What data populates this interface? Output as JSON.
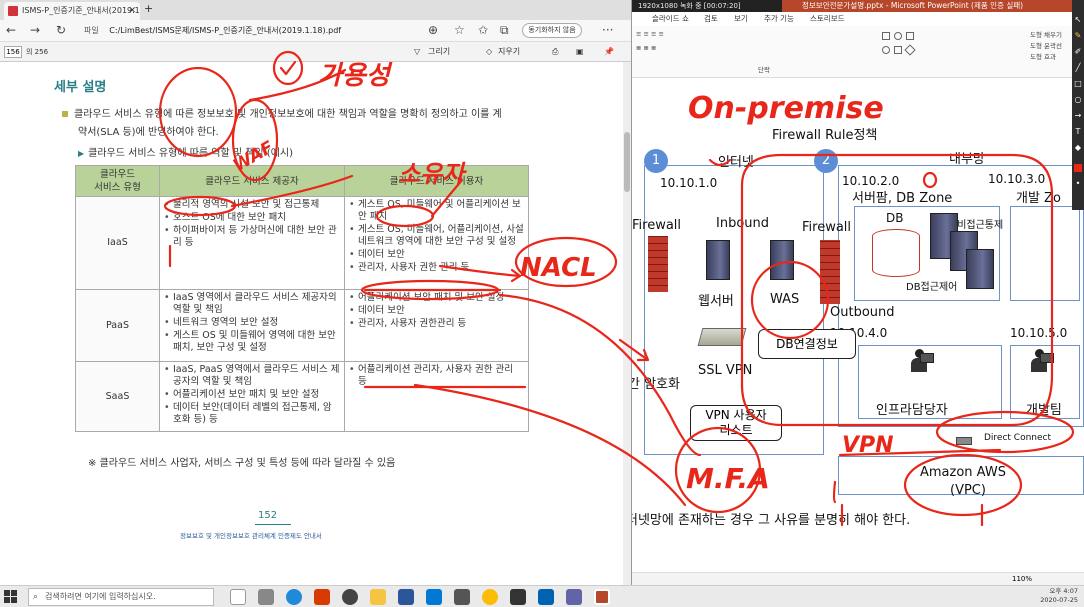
{
  "edge": {
    "tab_title": "ISMS-P_인증기준_안내서(2019.1",
    "new_tab": "+",
    "address_label": "파일",
    "address_url": "C:/LimBest/ISMS문제/ISMS-P_인증기준_안내서(2019.1.18).pdf",
    "sync_label": "동기화하지 않음"
  },
  "pdf_toolbar": {
    "page_current": "156",
    "page_total": "의 256",
    "draw_label": "그리기",
    "erase_label": "지우기"
  },
  "doc": {
    "heading": "세부 설명",
    "para_line1": "클라우드 서비스 유형에 따른 정보보호 및 개인정보보호에 대한 책임과 역할을 명확히 정의하고 이를 계",
    "para_line2": "약서(SLA 등)에 반영하여야 한다.",
    "sub_bullet": "클라우드 서비스 유형에 따른 역할 및 책임 (예시)",
    "table": {
      "headers": [
        "클라우드\n서비스 유형",
        "클라우드 서비스 제공자",
        "클라우드 서비스 이용자"
      ],
      "rows": [
        {
          "type": "IaaS",
          "provider": [
            "물리적 영역의 시설 보안 및 접근통제",
            "호스트 OS에 대한 보안 패치",
            "하이퍼바이저 등 가상머신에 대한 보안 관리 등"
          ],
          "user": [
            "게스트 OS, 미들웨어 및 어플리케이션 보안 패치",
            "게스트 OS, 미들웨어, 어플리케이션, 사설 네트워크 영역에 대한 보안 구성 및 설정",
            "데이터 보안",
            "관리자, 사용자 권한 관리 등"
          ]
        },
        {
          "type": "PaaS",
          "provider": [
            "IaaS 영역에서 클라우드 서비스 제공자의 역할 및 책임",
            "네트워크 영역의 보안 설정",
            "게스트 OS 및 미들웨어 영역에 대한 보안패치, 보안 구성 및 설정"
          ],
          "user": [
            "어플리케이션 보안 패치 및 보안 설정",
            "데이터 보안",
            "관리자, 사용자 권한관리 등"
          ]
        },
        {
          "type": "SaaS",
          "provider": [
            "IaaS, PaaS 영역에서 클라우드 서비스 제공자의 역할 및 책임",
            "어플리케이션 보안 패치 및 보안 설정",
            "데이터 보안(데이터 레벨의 접근통제, 암호화 등) 등"
          ],
          "user": [
            "어플리케이션 관리자, 사용자 권한 관리 등"
          ]
        }
      ]
    },
    "footnote": "※ 클라우드 서비스 사업자, 서비스 구성 및 특성 등에 따라 달라질 수 있음",
    "page_number": "152",
    "page_footer": "정보보호 및 개인정보보호 관리체계 인증제도 안내서"
  },
  "ppt": {
    "recorder": "1920x1080  녹화 중 [00:07:20]",
    "title": "정보보안전문가설명.pptx - Microsoft PowerPoint (제품 인증 실패)",
    "tabs": [
      "슬라이드 쇼",
      "검토",
      "보기",
      "추가 기능",
      "스토리보드"
    ],
    "ribbon_group": "단락",
    "ribbon_items": [
      "도형 채우기",
      "도형 윤곽선",
      "도형 효과"
    ]
  },
  "slide": {
    "title": "Firewall Rule정책",
    "internet_label": "인터넷",
    "internal_label": "내부망",
    "net_internet": "10.10.1.0",
    "net_server": "10.10.2.0",
    "net_dev": "10.10.3.0",
    "server_zone": "서버팜, DB Zone",
    "dev_zone": "개발 Zo",
    "db_label": "DB",
    "db_access_label": "세비접근통제",
    "db_access_label2": "DB접근제어",
    "firewall_left": "Firewall",
    "firewall_right": "Firewall",
    "inbound": "Inbound",
    "outbound": "Outbound",
    "web_server": "웹서버",
    "was": "WAS",
    "ssl_vpn": "SSL VPN",
    "encryption": "간 암호화",
    "net_infra": "10.10.4.0",
    "net_dev2": "10.10.5.0",
    "infra_admin": "인프라담당자",
    "dev_team": "개발팀",
    "direct_connect": "Direct Connect",
    "aws_line1": "Amazon AWS",
    "aws_line2": "(VPC)",
    "db_conn_callout": "DB연결정보",
    "vpn_callout_line1": "VPN 사용자",
    "vpn_callout_line2": "리스트",
    "bottom_text": "터넷망에 존재하는 경우 그 사유를 분명히 해야 한다.",
    "num1": "1",
    "num2": "2"
  },
  "annotations": {
    "on_premise": "On-premise",
    "ga_yong_seong": "가용성",
    "so_yu_ja": "소유자",
    "waf": "WAF",
    "nacl": "NACL",
    "vpn": "VPN",
    "mfa": "M.F.A"
  },
  "status": {
    "ppt_zoom": "110%",
    "search_placeholder": "검색하려면 여기에 입력하십시오.",
    "time": "오후 4:07",
    "date": "2020-07-25"
  },
  "colors": {
    "pen": "#e8271a",
    "table_header": "#b9d29a",
    "heading": "#2a7f86",
    "ppt_accent": "#b7472a"
  }
}
